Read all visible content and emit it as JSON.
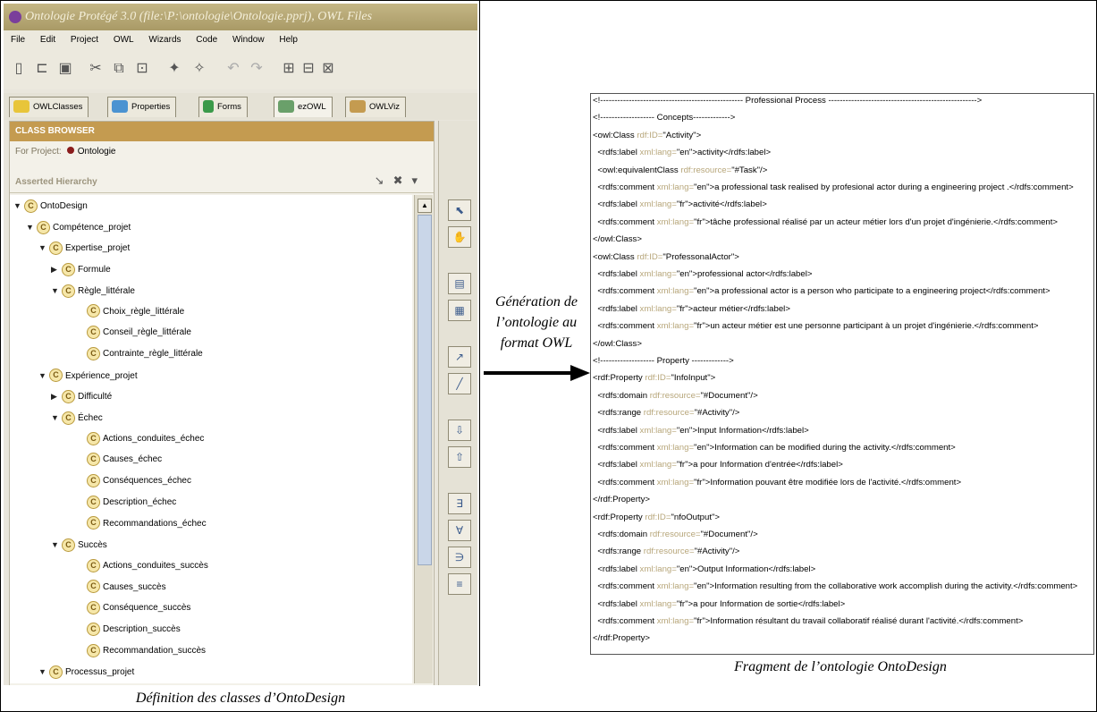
{
  "app": {
    "title": "Ontologie  Protégé 3.0    (file:\\P:\\ontologie\\Ontologie.pprj), OWL Files",
    "menu": [
      "File",
      "Edit",
      "Project",
      "OWL",
      "Wizards",
      "Code",
      "Window",
      "Help"
    ],
    "tabs": [
      {
        "label": "OWLClasses",
        "icon_color": "#e8c53a"
      },
      {
        "label": "Properties",
        "icon_color": "#4b93d1"
      },
      {
        "label": "Forms",
        "icon_color": "#3b9a4a"
      },
      {
        "label": "ezOWL",
        "icon_color": "#6aa06a"
      },
      {
        "label": "OWLViz",
        "icon_color": "#c49b50"
      }
    ],
    "class_browser_title": "CLASS BROWSER",
    "for_project_label": "For Project:",
    "project_name": "Ontologie",
    "asserted_hierarchy_label": "Asserted Hierarchy",
    "tree": [
      {
        "label": "OntoDesign",
        "toggle": "▼"
      },
      {
        "label": "Compétence_projet",
        "toggle": "▼"
      },
      {
        "label": "Expertise_projet",
        "toggle": "▼"
      },
      {
        "label": "Formule",
        "toggle": "▶"
      },
      {
        "label": "Règle_littérale",
        "toggle": "▼"
      },
      {
        "label": "Choix_règle_littérale",
        "toggle": ""
      },
      {
        "label": "Conseil_règle_littérale",
        "toggle": ""
      },
      {
        "label": "Contrainte_règle_littérale",
        "toggle": ""
      },
      {
        "label": "Expérience_projet",
        "toggle": "▼"
      },
      {
        "label": "Difficulté",
        "toggle": "▶"
      },
      {
        "label": "Échec",
        "toggle": "▼"
      },
      {
        "label": "Actions_conduites_échec",
        "toggle": ""
      },
      {
        "label": "Causes_échec",
        "toggle": ""
      },
      {
        "label": "Conséquences_échec",
        "toggle": ""
      },
      {
        "label": "Description_échec",
        "toggle": ""
      },
      {
        "label": "Recommandations_échec",
        "toggle": ""
      },
      {
        "label": "Succès",
        "toggle": "▼"
      },
      {
        "label": "Actions_conduites_succès",
        "toggle": ""
      },
      {
        "label": "Causes_succès",
        "toggle": ""
      },
      {
        "label": "Conséquence_succès",
        "toggle": ""
      },
      {
        "label": "Description_succès",
        "toggle": ""
      },
      {
        "label": "Recommandation_succès",
        "toggle": ""
      },
      {
        "label": "Processus_projet",
        "toggle": "▼"
      }
    ]
  },
  "arrow_caption": [
    "Génération de",
    "l’ontologie au",
    "format OWL"
  ],
  "caption_left": "Définition des classes d’OntoDesign",
  "caption_right": "Fragment de l’ontologie OntoDesign",
  "owl_code": [
    {
      "text": "<!-------------------------------------------------- Professional Process ---------------------------------------------------->"
    },
    {
      "text": "<!------------------- Concepts------------->"
    },
    {
      "text": "<owl:Class ",
      "attr": "rdf:ID=",
      "rest": "\"Activity\">"
    },
    {
      "text": "  <rdfs:label ",
      "attr": "xml:lang=",
      "rest": "\"en\">activity</rdfs:label>"
    },
    {
      "text": "  <owl:equivalentClass ",
      "attr": "rdf:resource=",
      "rest": "\"#Task\"/>"
    },
    {
      "text": "  <rdfs:comment ",
      "attr": "xml:lang=",
      "rest": "\"en\">a professional task realised by profesional actor during a engineering project .</rdfs:comment>"
    },
    {
      "text": "  <rdfs:label ",
      "attr": "xml:lang=",
      "rest": "\"fr\">activité</rdfs:label>"
    },
    {
      "text": "  <rdfs:comment ",
      "attr": "xml:lang=",
      "rest": "\"fr\">tâche professional réalisé par un acteur métier lors d'un projet d'ingénierie.</rdfs:comment>"
    },
    {
      "text": "</owl:Class>"
    },
    {
      "text": "<owl:Class ",
      "attr": "rdf:ID=",
      "rest": "\"ProfessonalActor\">"
    },
    {
      "text": "  <rdfs:label ",
      "attr": "xml:lang=",
      "rest": "\"en\">professional actor</rdfs:label>"
    },
    {
      "text": "  <rdfs:comment ",
      "attr": "xml:lang=",
      "rest": "\"en\">a professional actor is a person who participate to a engineering project</rdfs:comment>"
    },
    {
      "text": "  <rdfs:label ",
      "attr": "xml:lang=",
      "rest": "\"fr\">acteur métier</rdfs:label>"
    },
    {
      "text": "  <rdfs:comment ",
      "attr": "xml:lang=",
      "rest": "\"fr\">un acteur métier est une personne participant à un projet d'ingénierie.</rdfs:comment>"
    },
    {
      "text": "</owl:Class>"
    },
    {
      "text": "<!------------------- Property ------------->"
    },
    {
      "text": "<rdf:Property ",
      "attr": "rdf:ID=",
      "rest": "\"InfoInput\">"
    },
    {
      "text": "  <rdfs:domain ",
      "attr": "rdf:resource=",
      "rest": "\"#Document\"/>"
    },
    {
      "text": "  <rdfs:range ",
      "attr": "rdf:resource=",
      "rest": "\"#Activity\"/>"
    },
    {
      "text": "  <rdfs:label ",
      "attr": "xml:lang=",
      "rest": "\"en\">Input Information</rdfs:label>"
    },
    {
      "text": "  <rdfs:comment ",
      "attr": "xml:lang=",
      "rest": "\"en\">Information can be modified during the activity.</rdfs:comment>"
    },
    {
      "text": "  <rdfs:label ",
      "attr": "xml:lang=",
      "rest": "\"fr\">a pour Information d'entrée</rdfs:label>"
    },
    {
      "text": "  <rdfs:comment ",
      "attr": "xml:lang=",
      "rest": "\"fr\">Information pouvant être modifiée lors de l'activité.</rdfs:omment>"
    },
    {
      "text": "</rdf:Property>"
    },
    {
      "text": "<rdf:Property ",
      "attr": "rdf:ID=",
      "rest": "\"nfoOutput\">"
    },
    {
      "text": "  <rdfs:domain ",
      "attr": "rdf:resource=",
      "rest": "\"#Document\"/>"
    },
    {
      "text": "  <rdfs:range ",
      "attr": "rdf:resource=",
      "rest": "\"#Activity\"/>"
    },
    {
      "text": "  <rdfs:label ",
      "attr": "xml:lang=",
      "rest": "\"en\">Output Information</rdfs:label>"
    },
    {
      "text": "  <rdfs:comment ",
      "attr": "xml:lang=",
      "rest": "\"en\">Information resulting from the collaborative work accomplish during the activity.</rdfs:comment>"
    },
    {
      "text": "  <rdfs:label ",
      "attr": "xml:lang=",
      "rest": "\"fr\">a pour Information de sortie</rdfs:label>"
    },
    {
      "text": "  <rdfs:comment ",
      "attr": "xml:lang=",
      "rest": "\"fr\">Information résultant du travail collaboratif réalisé durant l'activité.</rdfs:comment>"
    },
    {
      "text": "</rdf:Property>"
    }
  ]
}
